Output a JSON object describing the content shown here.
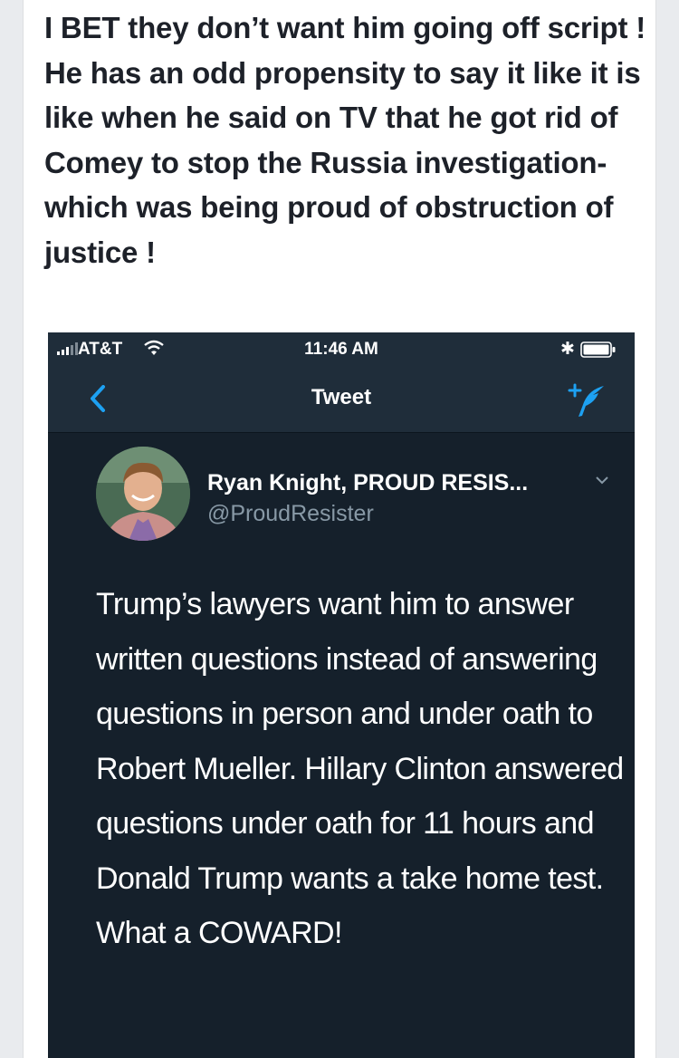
{
  "post": {
    "text": "I BET they don’t want him going off script ! He has an odd propensity to say it like it is like when he said on TV that he got rid of Comey to stop the Russia investigation- which was being proud of obstruction of justice !"
  },
  "screenshot": {
    "status_bar": {
      "carrier": "AT&T",
      "time": "11:46 AM",
      "icons": [
        "signal-icon",
        "wifi-icon",
        "bluetooth-icon",
        "battery-icon"
      ]
    },
    "nav": {
      "title": "Tweet",
      "back_icon": "chevron-left-icon",
      "compose_icon": "compose-tweet-icon"
    },
    "tweet": {
      "author_name": "Ryan Knight, PROUD RESIS...",
      "author_handle": "@ProudResister",
      "text": "Trump’s lawyers want him to answer written questions instead of answering questions in person and under oath to Robert Mueller. Hillary Clinton answered questions under oath for 11 hours and Donald Trump wants a take home test. What a COWARD!"
    }
  },
  "colors": {
    "page_background": "#e9ebee",
    "post_text": "#1d2129",
    "tweet_background": "#15202b",
    "bar_background": "#1f2d3a",
    "accent_blue": "#1da1f2",
    "handle_gray": "#8899a6"
  }
}
